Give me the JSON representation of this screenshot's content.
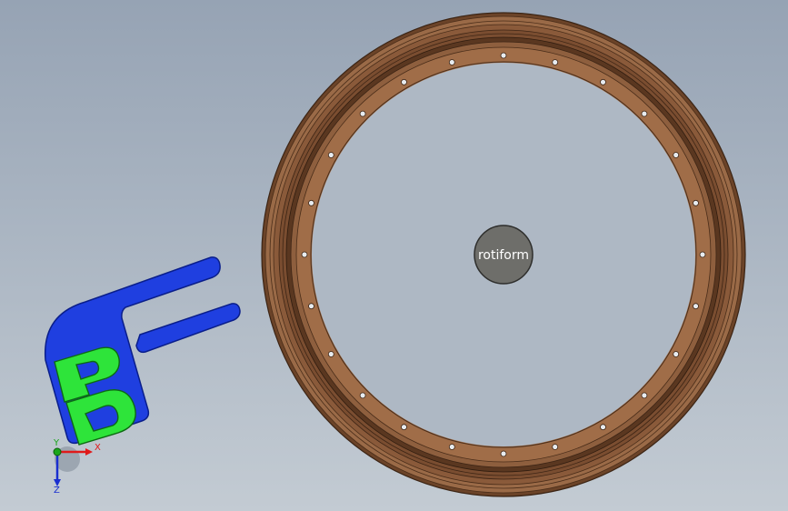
{
  "viewport": {
    "background_top": "#96a3b4",
    "background_bottom": "#c3cbd3"
  },
  "model": {
    "part": "wheel-rim",
    "rim_color": "#8a5a3a",
    "rim_dark": "#5f3b22",
    "rim_light": "#a6734d",
    "hole_count": 24,
    "hub": {
      "color": "#6e6e6a",
      "label": "rotiform"
    }
  },
  "logo": {
    "bracket_color": "#1f3fe0",
    "letters_color": "#2ee43a",
    "letters": [
      "P",
      "D"
    ]
  },
  "triad": {
    "x_label": "X",
    "y_label": "Y",
    "z_label": "Z",
    "x_color": "#e01a1a",
    "y_color": "#1aa51a",
    "z_color": "#1a2fd0"
  }
}
